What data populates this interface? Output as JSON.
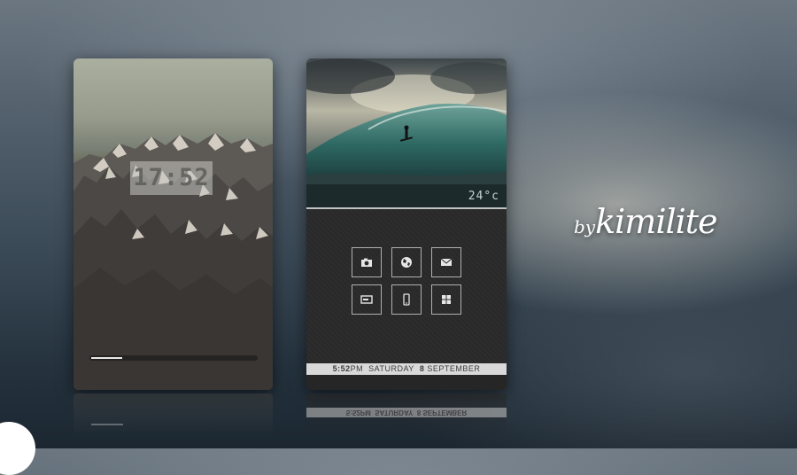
{
  "lockscreen": {
    "clock": "17:52",
    "unlock_progress_percent": 19
  },
  "homescreen": {
    "temperature": "24°c",
    "tiles": [
      {
        "icon": "camera-icon"
      },
      {
        "icon": "globe-icon"
      },
      {
        "icon": "mail-icon"
      },
      {
        "icon": "messages-icon"
      },
      {
        "icon": "phone-icon"
      },
      {
        "icon": "apps-grid-icon"
      }
    ],
    "status": {
      "time": "5:52",
      "ampm": "PM",
      "day": "SATURDAY",
      "date": "8",
      "month": "SEPTEMBER"
    }
  },
  "credit": {
    "by": "by",
    "author": "kimilite"
  },
  "colors": {
    "tile_border": "#dcdcdc",
    "statusbar_bg": "#d9d9d9",
    "home_bg": "#2a2a2a"
  }
}
